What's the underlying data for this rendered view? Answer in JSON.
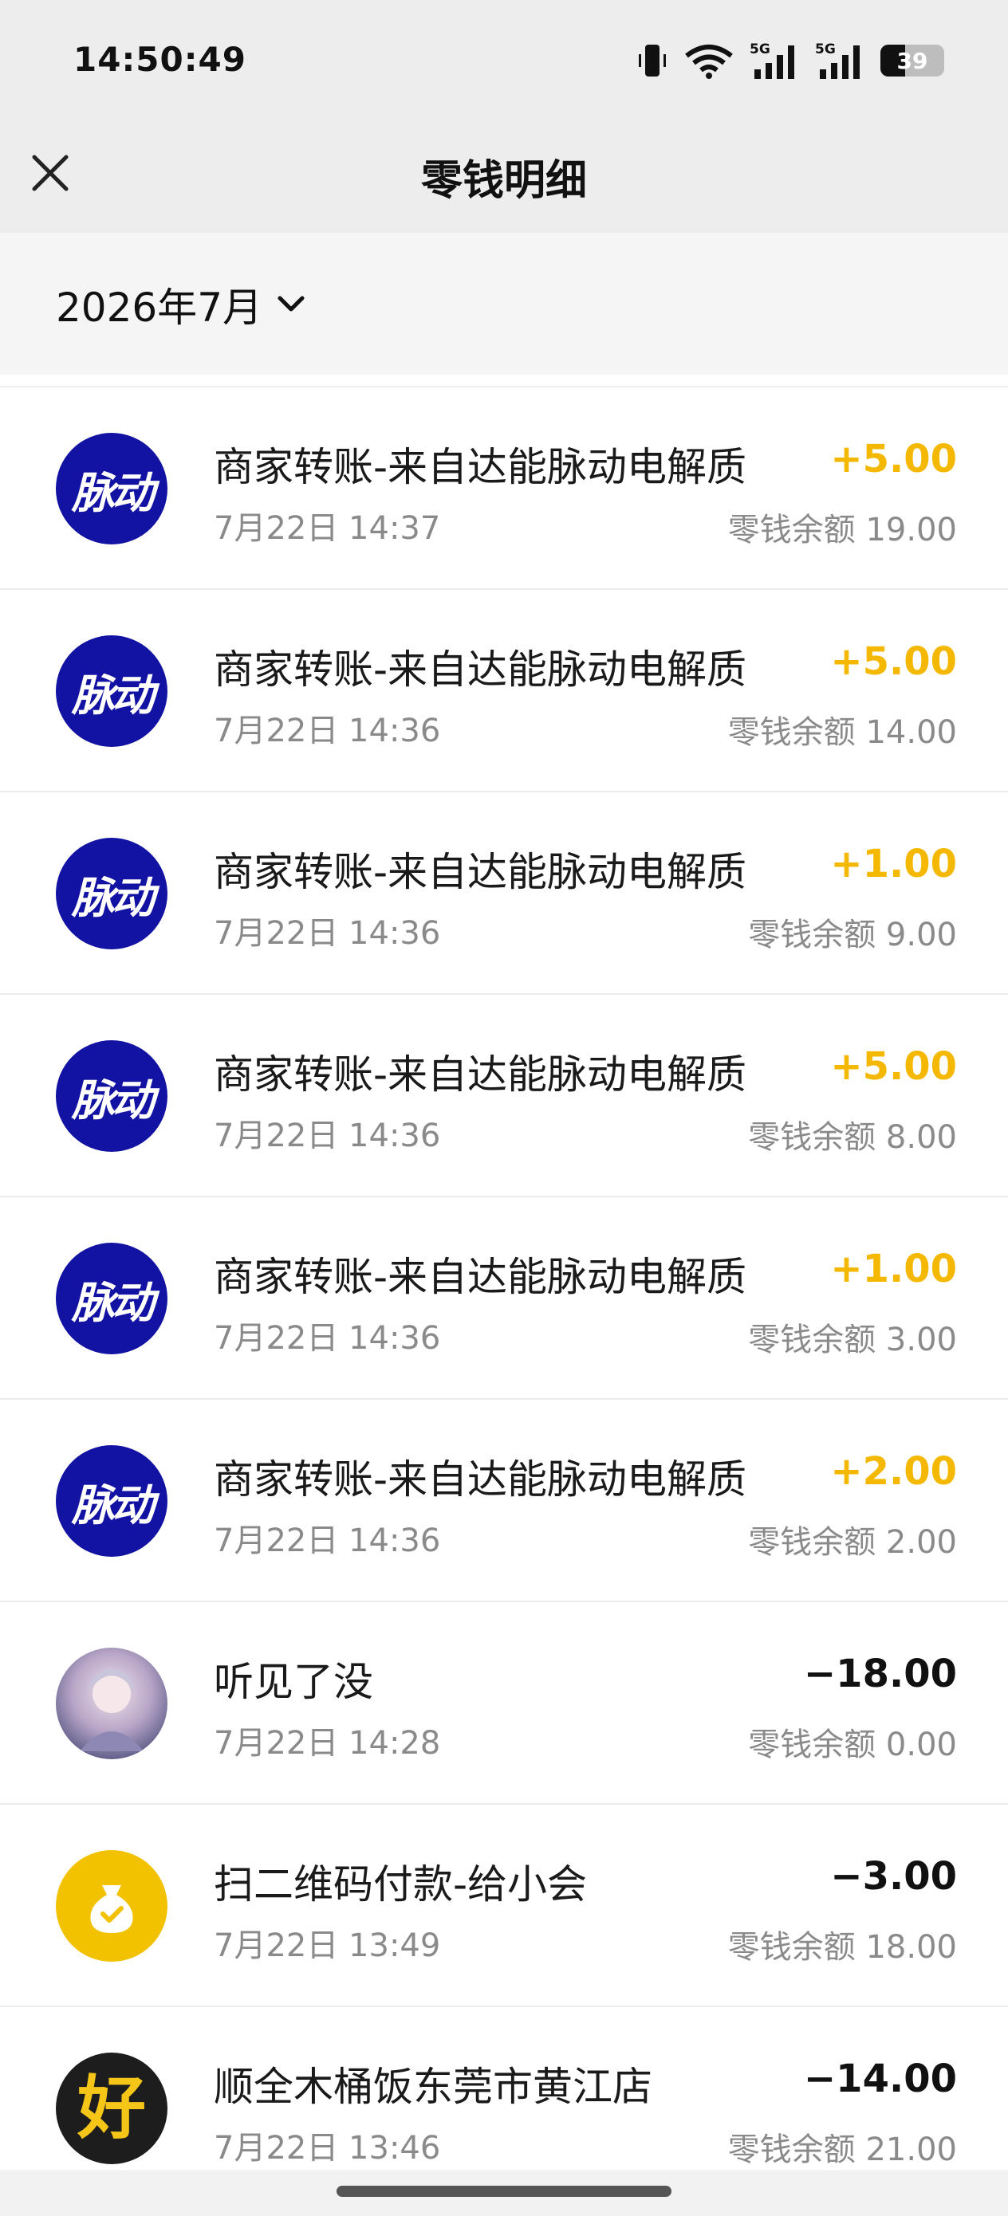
{
  "status_bar": {
    "time": "14:50:49",
    "battery_percent": 39,
    "battery_label": "39",
    "network_labels": [
      "5G",
      "5G"
    ]
  },
  "header": {
    "title": "零钱明细",
    "close_icon": "close-icon"
  },
  "filter": {
    "month_label": "2026年7月",
    "dropdown_icon": "chevron-down-icon"
  },
  "colors": {
    "income": "#f5b800",
    "expense": "#111111",
    "maidong_avatar": "#1212a3",
    "pay_avatar": "#f2c200"
  },
  "transactions": [
    {
      "name": "商家转账-来自达能脉动电解质",
      "time": "7月22日 14:37",
      "amount": "+5.00",
      "type": "income",
      "balance": "零钱余额 19.00",
      "avatar": "脉动"
    },
    {
      "name": "商家转账-来自达能脉动电解质",
      "time": "7月22日 14:36",
      "amount": "+5.00",
      "type": "income",
      "balance": "零钱余额 14.00",
      "avatar": "脉动"
    },
    {
      "name": "商家转账-来自达能脉动电解质",
      "time": "7月22日 14:36",
      "amount": "+1.00",
      "type": "income",
      "balance": "零钱余额 9.00",
      "avatar": "脉动"
    },
    {
      "name": "商家转账-来自达能脉动电解质",
      "time": "7月22日 14:36",
      "amount": "+5.00",
      "type": "income",
      "balance": "零钱余额 8.00",
      "avatar": "脉动"
    },
    {
      "name": "商家转账-来自达能脉动电解质",
      "time": "7月22日 14:36",
      "amount": "+1.00",
      "type": "income",
      "balance": "零钱余额 3.00",
      "avatar": "脉动"
    },
    {
      "name": "商家转账-来自达能脉动电解质",
      "time": "7月22日 14:36",
      "amount": "+2.00",
      "type": "income",
      "balance": "零钱余额 2.00",
      "avatar": "脉动"
    },
    {
      "name": "听见了没",
      "time": "7月22日 14:28",
      "amount": "−18.00",
      "type": "expense",
      "balance": "零钱余额 0.00",
      "avatar": "person"
    },
    {
      "name": "扫二维码付款-给小会",
      "time": "7月22日 13:49",
      "amount": "−3.00",
      "type": "expense",
      "balance": "零钱余额 18.00",
      "avatar": "money-bag-icon"
    },
    {
      "name": "顺全木桶饭东莞市黄江店",
      "time": "7月22日 13:46",
      "amount": "−14.00",
      "type": "expense",
      "balance": "零钱余额 21.00",
      "avatar": "好"
    }
  ]
}
